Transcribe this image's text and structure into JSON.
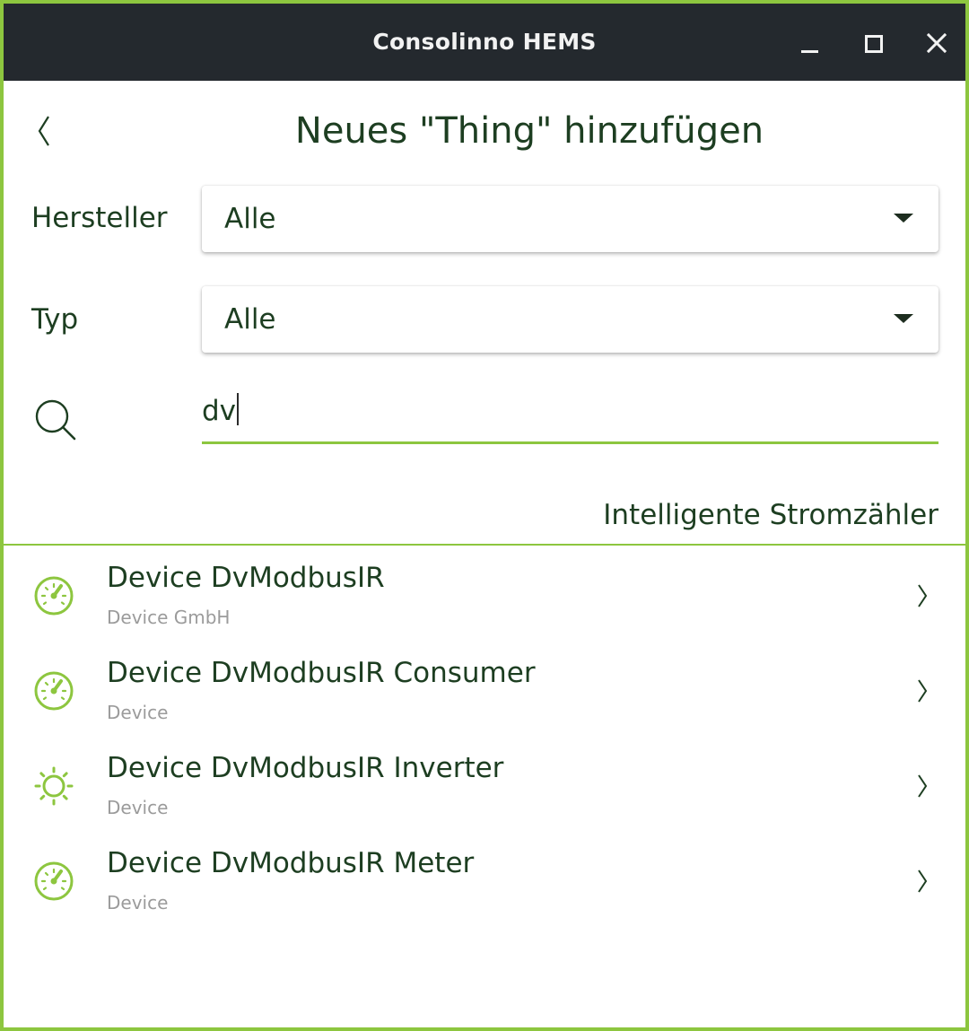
{
  "window": {
    "title": "Consolinno HEMS",
    "controls": [
      "minimize-icon",
      "maximize-icon",
      "close-icon"
    ]
  },
  "page": {
    "title": "Neues \"Thing\" hinzufügen",
    "back_icon": "chevron-left-icon"
  },
  "filters": {
    "vendor_label": "Hersteller",
    "vendor_value": "Alle",
    "type_label": "Typ",
    "type_value": "Alle",
    "search_icon": "search-icon",
    "search_value": "dv"
  },
  "section": {
    "header": "Intelligente Stromzähler"
  },
  "items": [
    {
      "name": "Device DvModbusIR",
      "vendor": "Device GmbH",
      "icon": "gauge-icon"
    },
    {
      "name": "Device DvModbusIR Consumer",
      "vendor": "Device",
      "icon": "gauge-icon"
    },
    {
      "name": "Device DvModbusIR Inverter",
      "vendor": "Device",
      "icon": "sun-icon"
    },
    {
      "name": "Device DvModbusIR Meter",
      "vendor": "Device",
      "icon": "gauge-icon"
    }
  ],
  "colors": {
    "accent": "#8dc63f",
    "titlebar": "#24292e",
    "text": "#1d3e21",
    "subtext": "#9b9b9b"
  }
}
